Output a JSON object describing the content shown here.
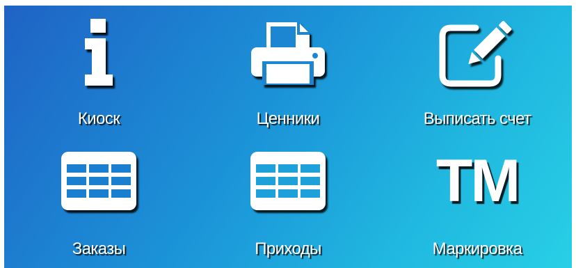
{
  "tiles": [
    {
      "id": "kiosk",
      "label": "Киоск",
      "icon": "info-icon"
    },
    {
      "id": "price-tags",
      "label": "Ценники",
      "icon": "printer-icon"
    },
    {
      "id": "invoice",
      "label": "Выписать счет",
      "icon": "edit-icon"
    },
    {
      "id": "orders",
      "label": "Заказы",
      "icon": "table-icon"
    },
    {
      "id": "receipts",
      "label": "Приходы",
      "icon": "table-icon"
    },
    {
      "id": "marking",
      "label": "Маркировка",
      "icon": "tm-icon",
      "icon_text": "TM"
    }
  ],
  "colors": {
    "gradient_start": "#1f63c4",
    "gradient_end": "#28cfe6",
    "text": "#ffffff"
  }
}
